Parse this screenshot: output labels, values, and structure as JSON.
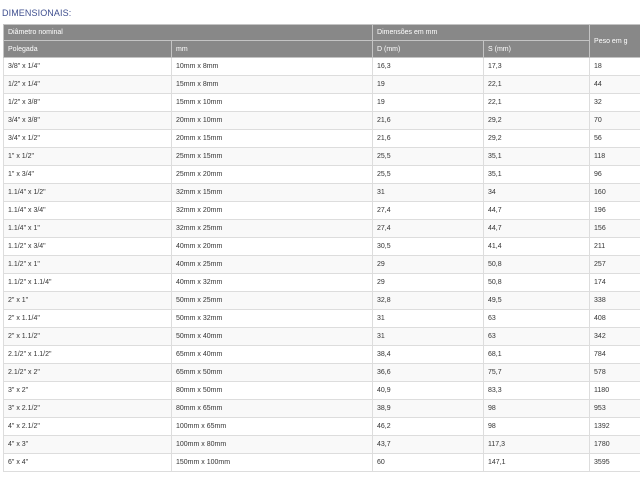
{
  "heading": "DIMENSIONAIS:",
  "table": {
    "header": {
      "nominal": "Diâmetro nominal",
      "dimensions": "Dimensões em mm",
      "weight": "Peso em g",
      "inch": "Polegada",
      "mm": "mm",
      "d": "D (mm)",
      "s": "S (mm)"
    },
    "rows": [
      {
        "pol": "3/8\" x 1/4\"",
        "mm": "10mm x 8mm",
        "d": "16,3",
        "s": "17,3",
        "peso": "18"
      },
      {
        "pol": "1/2\" x 1/4\"",
        "mm": "15mm x 8mm",
        "d": "19",
        "s": "22,1",
        "peso": "44"
      },
      {
        "pol": "1/2\" x 3/8\"",
        "mm": "15mm x 10mm",
        "d": "19",
        "s": "22,1",
        "peso": "32"
      },
      {
        "pol": "3/4\" x 3/8\"",
        "mm": "20mm x 10mm",
        "d": "21,6",
        "s": "29,2",
        "peso": "70"
      },
      {
        "pol": "3/4\" x 1/2\"",
        "mm": "20mm x 15mm",
        "d": "21,6",
        "s": "29,2",
        "peso": "56"
      },
      {
        "pol": "1\" x 1/2\"",
        "mm": "25mm x 15mm",
        "d": "25,5",
        "s": "35,1",
        "peso": "118"
      },
      {
        "pol": "1\" x 3/4\"",
        "mm": "25mm x 20mm",
        "d": "25,5",
        "s": "35,1",
        "peso": "96"
      },
      {
        "pol": "1.1/4\" x 1/2\"",
        "mm": "32mm x 15mm",
        "d": "31",
        "s": "34",
        "peso": "160"
      },
      {
        "pol": "1.1/4\" x 3/4\"",
        "mm": "32mm x 20mm",
        "d": "27,4",
        "s": "44,7",
        "peso": "196"
      },
      {
        "pol": "1.1/4\" x 1\"",
        "mm": "32mm x 25mm",
        "d": "27,4",
        "s": "44,7",
        "peso": "156"
      },
      {
        "pol": "1.1/2\" x 3/4\"",
        "mm": "40mm x 20mm",
        "d": "30,5",
        "s": "41,4",
        "peso": "211"
      },
      {
        "pol": "1.1/2\" x 1\"",
        "mm": "40mm x 25mm",
        "d": "29",
        "s": "50,8",
        "peso": "257"
      },
      {
        "pol": "1.1/2\" x 1.1/4\"",
        "mm": "40mm x 32mm",
        "d": "29",
        "s": "50,8",
        "peso": "174"
      },
      {
        "pol": "2\" x 1\"",
        "mm": "50mm x 25mm",
        "d": "32,8",
        "s": "49,5",
        "peso": "338"
      },
      {
        "pol": "2\" x 1.1/4\"",
        "mm": "50mm x 32mm",
        "d": "31",
        "s": "63",
        "peso": "408"
      },
      {
        "pol": "2\" x 1.1/2\"",
        "mm": "50mm x 40mm",
        "d": "31",
        "s": "63",
        "peso": "342"
      },
      {
        "pol": "2.1/2\" x 1.1/2\"",
        "mm": "65mm x 40mm",
        "d": "38,4",
        "s": "68,1",
        "peso": "784"
      },
      {
        "pol": "2.1/2\" x 2\"",
        "mm": "65mm x 50mm",
        "d": "36,6",
        "s": "75,7",
        "peso": "578"
      },
      {
        "pol": "3\" x 2\"",
        "mm": "80mm x 50mm",
        "d": "40,9",
        "s": "83,3",
        "peso": "1180"
      },
      {
        "pol": "3\" x 2.1/2\"",
        "mm": "80mm x 65mm",
        "d": "38,9",
        "s": "98",
        "peso": "953"
      },
      {
        "pol": "4\" x 2.1/2\"",
        "mm": "100mm x 65mm",
        "d": "46,2",
        "s": "98",
        "peso": "1392"
      },
      {
        "pol": "4\" x 3\"",
        "mm": "100mm x 80mm",
        "d": "43,7",
        "s": "117,3",
        "peso": "1780"
      },
      {
        "pol": "6\" x 4\"",
        "mm": "150mm x 100mm",
        "d": "60",
        "s": "147,1",
        "peso": "3595"
      }
    ]
  }
}
